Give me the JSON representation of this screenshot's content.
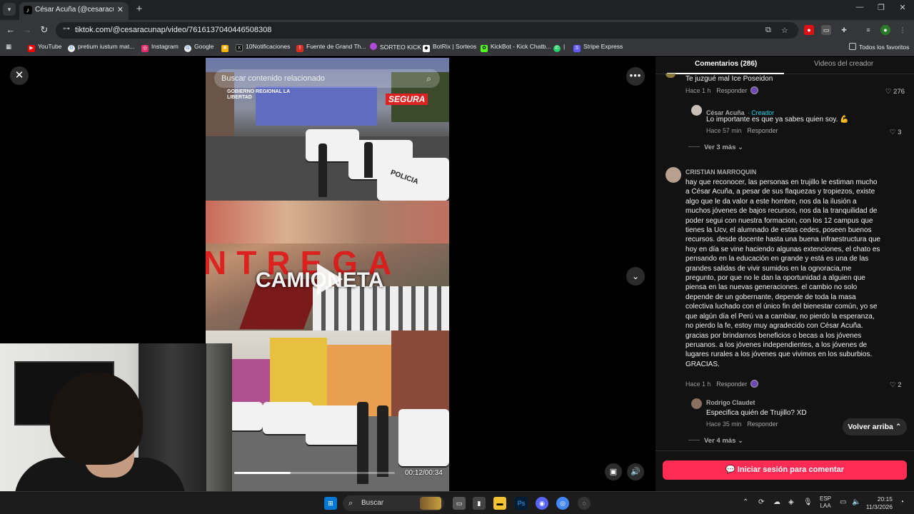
{
  "browser": {
    "tab_title": "César Acuña (@cesaracunap) | T",
    "url": "tiktok.com/@cesaracunap/video/7616137040446508308",
    "bookmarks": [
      {
        "label": "YouTube",
        "color": "#ff0000"
      },
      {
        "label": "pretium iustum mat...",
        "color": "#4285f4"
      },
      {
        "label": "Instagram",
        "color": "#e1306c"
      },
      {
        "label": "Google",
        "color": "#4285f4"
      },
      {
        "label": "",
        "color": "#f4b400"
      },
      {
        "label": "10Notificaciones",
        "color": "#000000"
      },
      {
        "label": "Fuente de Grand Th...",
        "color": "#d93025"
      },
      {
        "label": "SORTEO KICK",
        "color": "#b04ad8"
      },
      {
        "label": "BotRix | Sorteos",
        "color": "#ffffff"
      },
      {
        "label": "KickBot - Kick Chatb...",
        "color": "#53fc18"
      },
      {
        "label": "|",
        "color": "#25d366"
      },
      {
        "label": "Stripe Express",
        "color": "#635bff"
      }
    ],
    "all_favorites": "Todos los favoritos"
  },
  "video": {
    "search_placeholder": "Buscar contenido relacionado",
    "overlay_text_red": "NTREGA",
    "overlay_text_white": "CAMIONETA",
    "logo_region": "GOBIERNO REGIONAL LA LIBERTAD",
    "logo_segura": "SEGURA",
    "car_text": "POLICIA",
    "time": "00:12/00:34",
    "progress": 0.35
  },
  "panel": {
    "tab_comments": "Comentarios (286)",
    "tab_creator_videos": "Videos del creador",
    "reply_label": "Responder",
    "comments": [
      {
        "text": "Te juzgué mal Ice Poseidon",
        "time": "Hace 1 h",
        "likes": "276"
      },
      {
        "name": "César Acuña",
        "badge": "· Creador",
        "text": "Lo importante es que ya sabes quien soy. 💪",
        "time": "Hace 57 min",
        "likes": "3"
      },
      {
        "name": "CRISTIAN MARROQUIN",
        "text": "hay que reconocer, las personas en trujillo le estiman mucho a César Acuña, a pesar de sus flaquezas y tropiezos, existe algo que le da valor a este hombre, nos da la ilusión a muchos jóvenes de bajos recursos, nos da la tranquilidad de poder segui con nuestra formacion, con los 12 campus que tienes la Ucv, el alumnado de estas cedes, poseen buenos recursos. desde docente hasta una buena infraestructura que hoy en día se vine haciendo algunas extenciones, el chato es pensando en la educación en grande y está es una de las grandes salidas de vivir sumidos en la ognoracia,me pregunto, por que no le dan la oportunidad a alguien que piensa en las nuevas generaciones. el cambio no solo depende de un gobernante, depende de toda la masa colectiva luchado con el único fin del bienestar común, yo se que algún día el Perú va a cambiar, no pierdo la esperanza, no pierdo la fe, estoy muy agradecido con César Acuña. gracias por brindarnos beneficios o becas a los jóvenes peruanos. a los jóvenes independientes, a los jóvenes de lugares rurales a los jóvenes que vivimos en los suburbios. GRACIAS.",
        "time": "Hace 1 h",
        "likes": "2"
      },
      {
        "name": "Rodrigo Claudet",
        "text": "Especifica quién de Trujillo? XD",
        "time": "Hace 35 min"
      }
    ],
    "see_more_1": "Ver 3 más",
    "see_more_2": "Ver 4 más",
    "back_to_top": "Volver arriba",
    "login_to_comment": "Iniciar sesión para comentar"
  },
  "taskbar": {
    "search_label": "Buscar",
    "lang_top": "ESP",
    "lang_bottom": "LAA",
    "time": "20:15",
    "date": "11/3/2026"
  }
}
